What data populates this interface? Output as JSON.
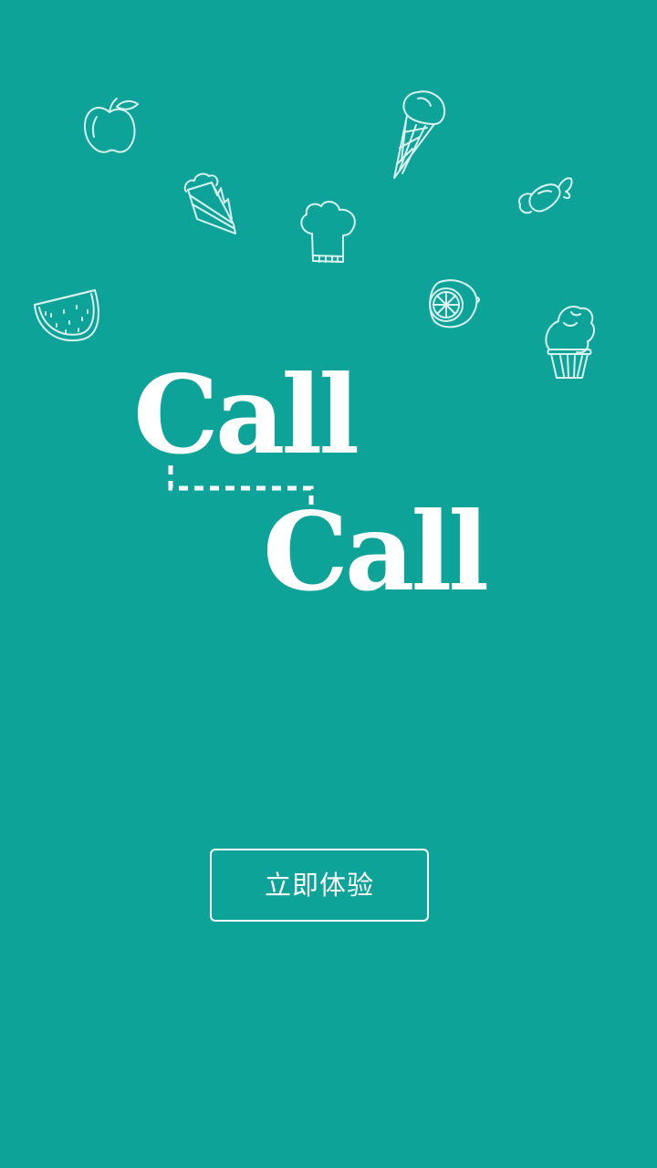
{
  "app": {
    "logo_line1": "Call",
    "logo_line2": "Call"
  },
  "cta": {
    "label": "立即体验"
  },
  "colors": {
    "background": "#0ea399",
    "foreground": "#ffffff",
    "doodle_stroke": "#d9f2ef"
  },
  "doodles": [
    "apple-icon",
    "ice-cream-cone-icon",
    "cake-slice-icon",
    "chef-hat-icon",
    "candy-icon",
    "watermelon-icon",
    "lemon-icon",
    "cupcake-icon"
  ]
}
